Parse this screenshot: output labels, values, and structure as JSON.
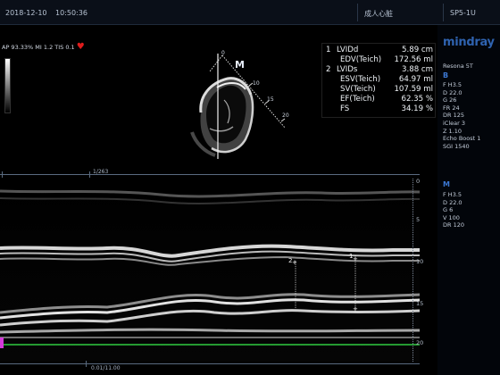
{
  "header": {
    "date": "2018-12-10",
    "time": "10:50:36",
    "preset": "成人心脏",
    "probe": "SP5-1U"
  },
  "info_line": {
    "text": "AP 93.33%  MI 1.2  TIS 0.1"
  },
  "brand": {
    "name": "mindray",
    "model": "Resona 5T"
  },
  "b_mode": {
    "label": "B",
    "params": [
      "F H3.5",
      "D 22.0",
      "G 26",
      "FR 24",
      "DR 125",
      "iClear 3",
      "Z 1.10",
      "Echo Boost 1",
      "SGI 1540"
    ]
  },
  "m_mode": {
    "label": "M",
    "params": [
      "F H3.5",
      "D 22.0",
      "G 6",
      "V 100",
      "DR 120"
    ]
  },
  "measurements": [
    {
      "num": "1",
      "label": "LVIDd",
      "value": "5.89 cm",
      "indent": false
    },
    {
      "num": "",
      "label": "EDV(Teich)",
      "value": "172.56 ml",
      "indent": true
    },
    {
      "num": "2",
      "label": "LVIDs",
      "value": "3.88 cm",
      "indent": false
    },
    {
      "num": "",
      "label": "ESV(Teich)",
      "value": "64.97 ml",
      "indent": true
    },
    {
      "num": "",
      "label": "SV(Teich)",
      "value": "107.59 ml",
      "indent": true
    },
    {
      "num": "",
      "label": "EF(Teich)",
      "value": "62.35 %",
      "indent": true
    },
    {
      "num": "",
      "label": "FS",
      "value": "34.19 %",
      "indent": true
    }
  ],
  "sector": {
    "marker": "M",
    "depth_ticks": [
      "0",
      "10",
      "15",
      "20"
    ]
  },
  "frame_counter": "1/263",
  "mmode_depth": [
    "0",
    "5",
    "10",
    "15",
    "20"
  ],
  "caliper_labels": [
    "2",
    "1"
  ],
  "timeline": "0.01/11.00",
  "colors": {
    "brand": "#2f63b0",
    "heart": "#e01c1c",
    "ecg": "#2ecc40"
  }
}
